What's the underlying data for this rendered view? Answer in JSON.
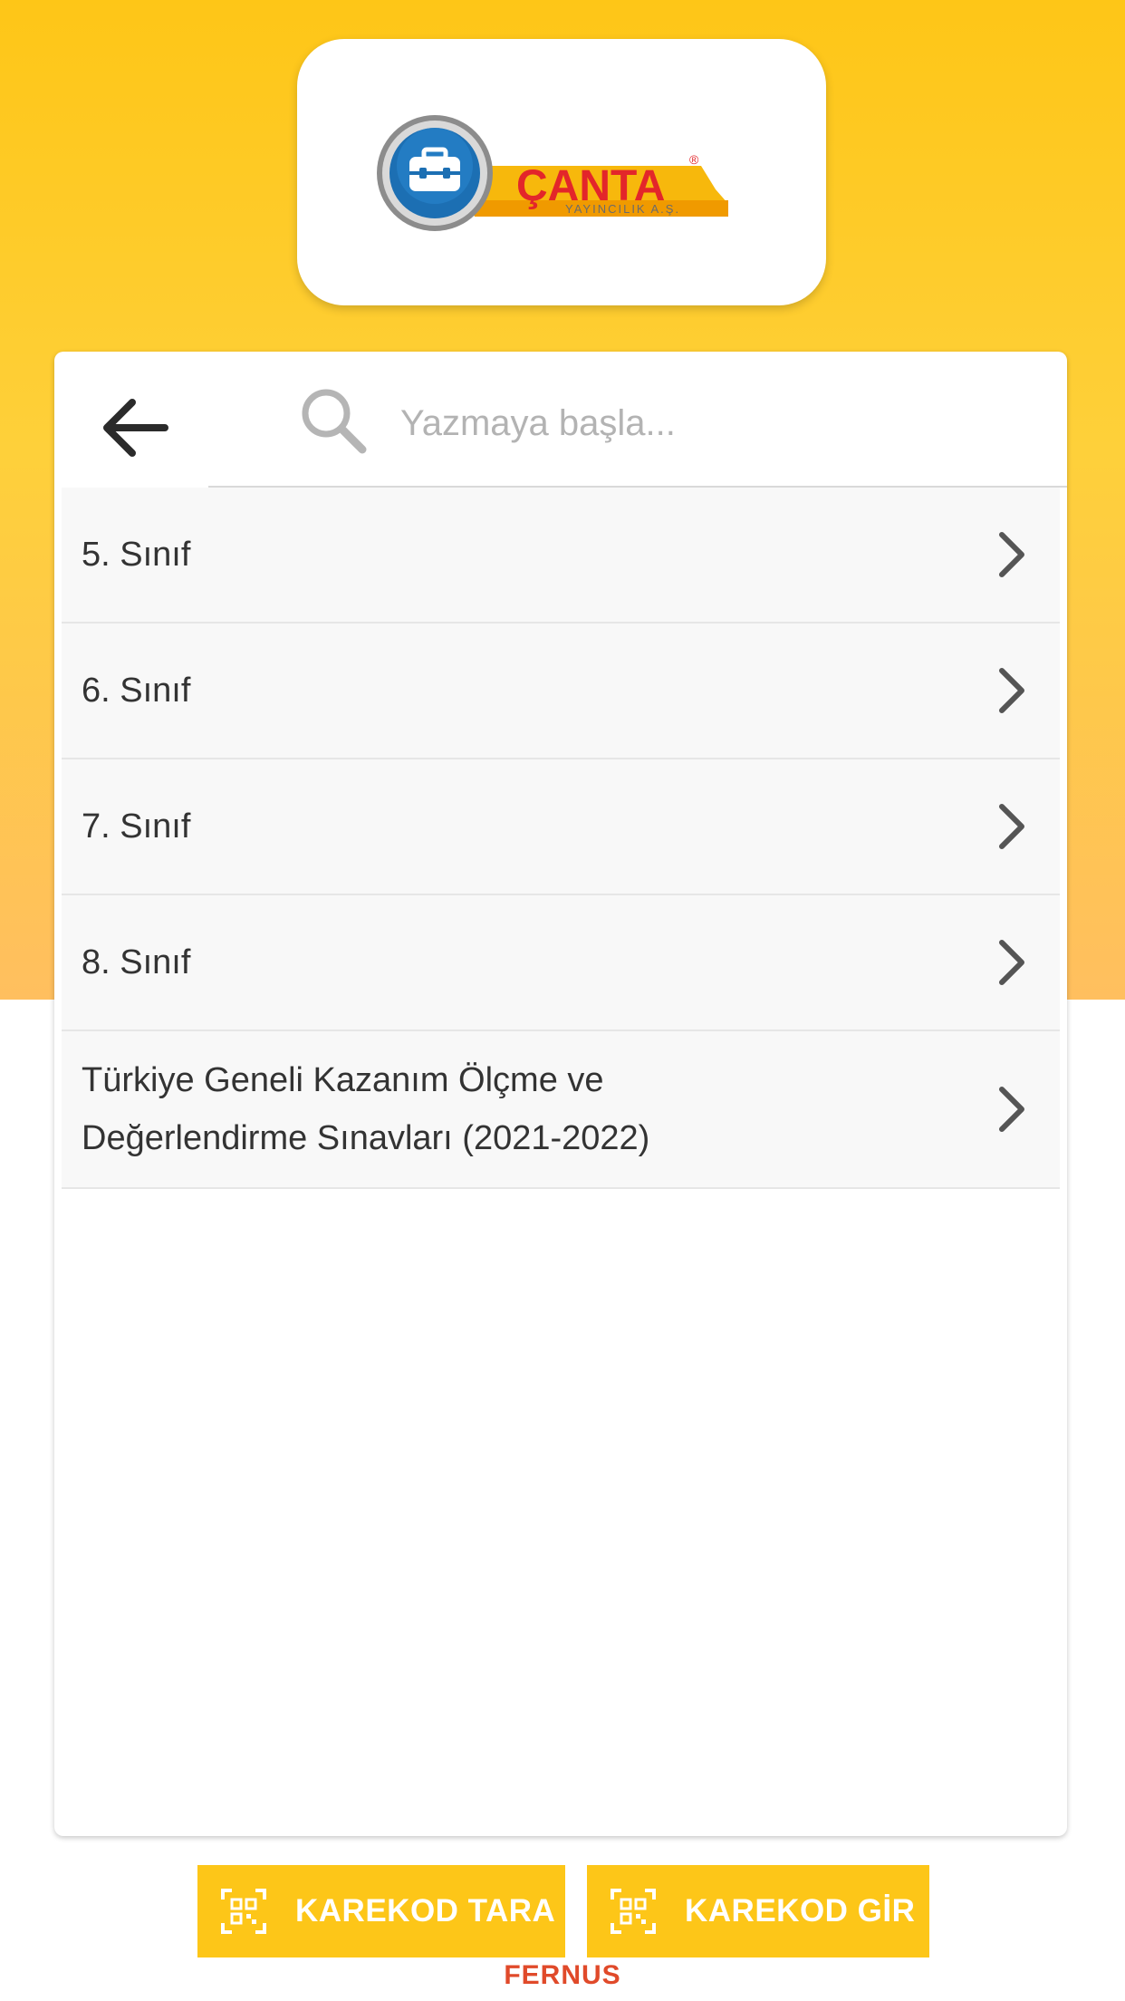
{
  "logo": {
    "brand_name": "ÇANTA",
    "tagline": "YAYINCILIK A.Ş.",
    "registered_mark": "®"
  },
  "search": {
    "placeholder": "Yazmaya başla...",
    "value": ""
  },
  "categories": [
    {
      "label": "5. Sınıf",
      "icon": "chevron-right-icon"
    },
    {
      "label": "6. Sınıf",
      "icon": "chevron-right-icon"
    },
    {
      "label": "7. Sınıf",
      "icon": "chevron-right-icon"
    },
    {
      "label": "8. Sınıf",
      "icon": "chevron-right-icon"
    },
    {
      "label": "Türkiye Geneli Kazanım Ölçme ve Değerlendirme Sınavları (2021-2022)",
      "icon": "chevron-right-icon"
    }
  ],
  "actions": {
    "scan_label": "KAREKOD TARA",
    "enter_label": "KAREKOD GİR"
  },
  "footer": {
    "brand": "FERNUS"
  },
  "colors": {
    "accent_yellow": "#fdc618",
    "logo_red": "#e3262a",
    "logo_blue": "#1c6fb3",
    "footer_red": "#e04a2a",
    "text": "#333333",
    "placeholder": "#b3b3b3"
  }
}
